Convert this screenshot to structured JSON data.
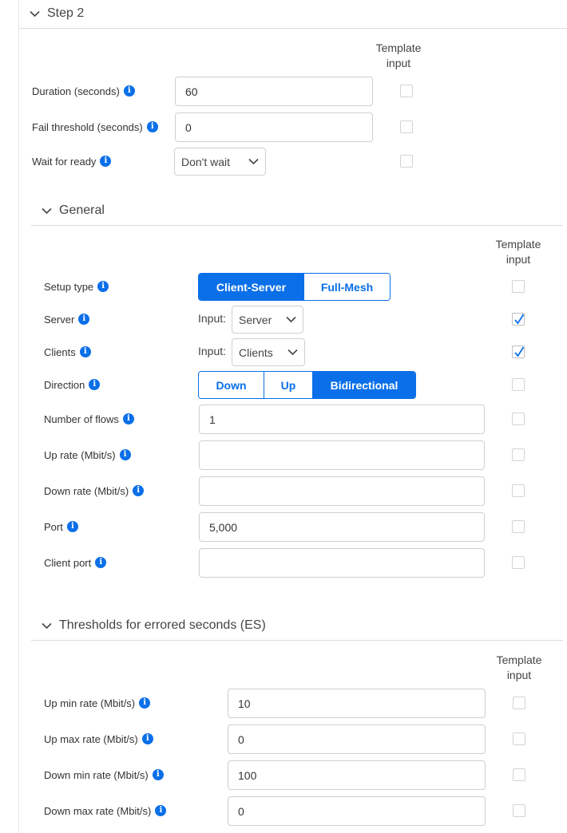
{
  "step": {
    "title": "Step 2",
    "template_header": "Template input"
  },
  "step_fields": {
    "duration": {
      "label": "Duration (seconds)",
      "value": "60"
    },
    "fail_threshold": {
      "label": "Fail threshold (seconds)",
      "value": "0"
    },
    "wait_for_ready": {
      "label": "Wait for ready",
      "selected": "Don't wait"
    }
  },
  "general": {
    "title": "General",
    "template_header": "Template input",
    "setup_type": {
      "label": "Setup type",
      "options": [
        "Client-Server",
        "Full-Mesh"
      ],
      "selected": "Client-Server"
    },
    "server": {
      "label": "Server",
      "prefix": "Input:",
      "selected": "Server",
      "template_checked": true
    },
    "clients": {
      "label": "Clients",
      "prefix": "Input:",
      "selected": "Clients",
      "template_checked": true
    },
    "direction": {
      "label": "Direction",
      "options": [
        "Down",
        "Up",
        "Bidirectional"
      ],
      "selected": "Bidirectional"
    },
    "num_flows": {
      "label": "Number of flows",
      "value": "1"
    },
    "up_rate": {
      "label": "Up rate (Mbit/s)",
      "value": ""
    },
    "down_rate": {
      "label": "Down rate (Mbit/s)",
      "value": ""
    },
    "port": {
      "label": "Port",
      "value": "5,000"
    },
    "client_port": {
      "label": "Client port",
      "value": ""
    }
  },
  "thresholds": {
    "title": "Thresholds for errored seconds (ES)",
    "template_header": "Template input",
    "up_min": {
      "label": "Up min rate (Mbit/s)",
      "value": "10"
    },
    "up_max": {
      "label": "Up max rate (Mbit/s)",
      "value": "0"
    },
    "down_min": {
      "label": "Down min rate (Mbit/s)",
      "value": "100"
    },
    "down_max": {
      "label": "Down max rate (Mbit/s)",
      "value": "0"
    }
  },
  "icons": {
    "info": "info-icon",
    "collapse": "chevron-down-icon",
    "dropdown": "chevron-down-icon",
    "check": "checkmark-icon"
  },
  "colors": {
    "accent": "#0a6fe8",
    "border": "#cfcfcf",
    "text": "#333333"
  }
}
